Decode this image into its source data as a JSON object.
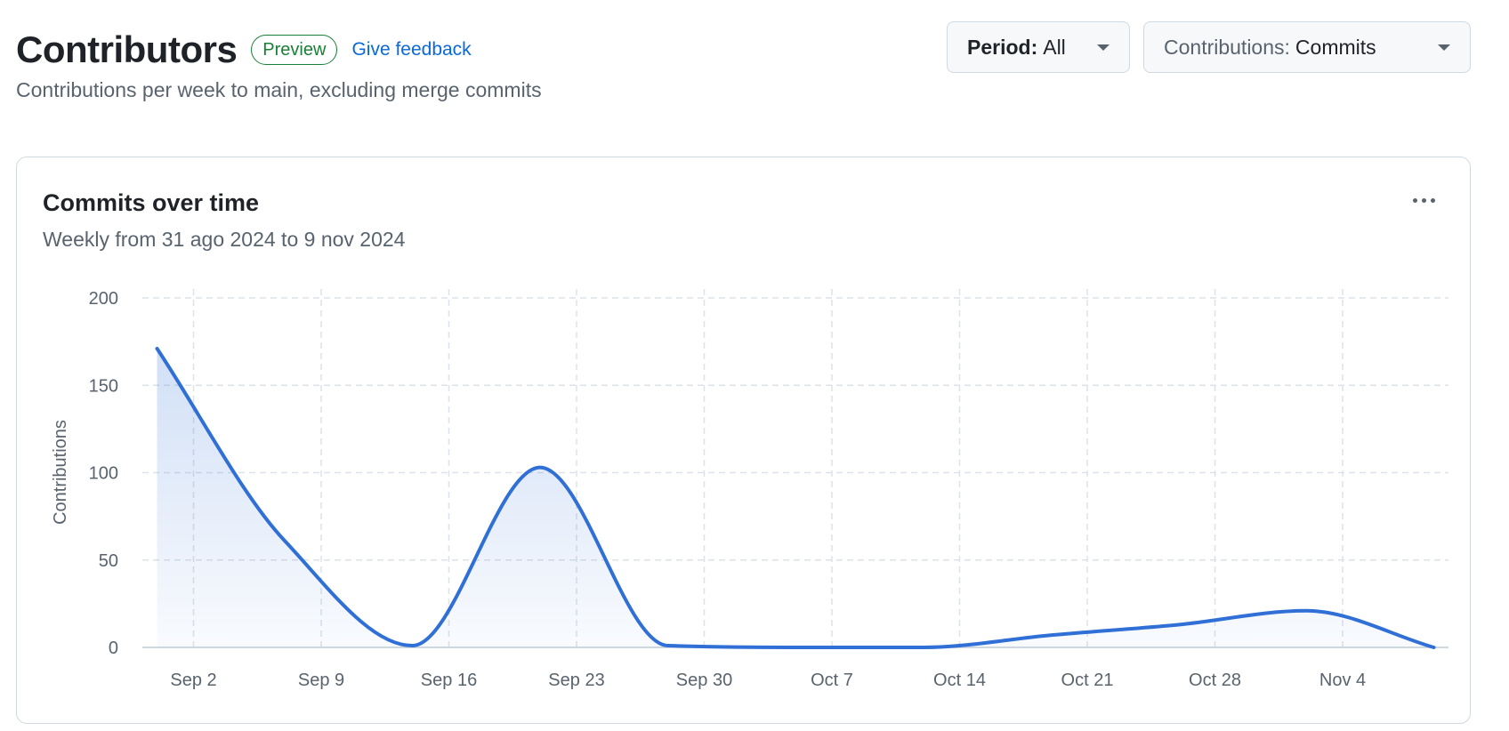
{
  "header": {
    "title": "Contributors",
    "badge": "Preview",
    "feedback_link": "Give feedback",
    "subtitle": "Contributions per week to main, excluding merge commits"
  },
  "filters": {
    "period_label": "Period:",
    "period_value": "All",
    "contributions_label": "Contributions:",
    "contributions_value": "Commits"
  },
  "card": {
    "title": "Commits over time",
    "subtitle": "Weekly from 31 ago 2024 to 9 nov 2024",
    "menu_icon": "kebab-horizontal-icon"
  },
  "colors": {
    "line": "#2f6fd6",
    "grid": "#dde2e8",
    "accent_badge": "#1a7f37",
    "link": "#0969da"
  },
  "chart_data": {
    "type": "area",
    "title": "Commits over time",
    "ylabel": "Contributions",
    "xlabel": "",
    "ylim": [
      0,
      200
    ],
    "y_ticks": [
      0,
      50,
      100,
      150,
      200
    ],
    "x_ticks": [
      "Sep 2",
      "Sep 9",
      "Sep 16",
      "Sep 23",
      "Sep 30",
      "Oct 7",
      "Oct 14",
      "Oct 21",
      "Oct 28",
      "Nov 4"
    ],
    "grid": true,
    "series": [
      {
        "x": [
          "2024-08-31",
          "2024-09-07",
          "2024-09-14",
          "2024-09-21",
          "2024-09-28",
          "2024-10-05",
          "2024-10-12",
          "2024-10-19",
          "2024-10-26",
          "2024-11-02",
          "2024-11-09"
        ],
        "values": [
          171,
          61,
          1,
          103,
          1,
          0,
          0,
          7,
          13,
          21,
          0
        ]
      }
    ]
  }
}
